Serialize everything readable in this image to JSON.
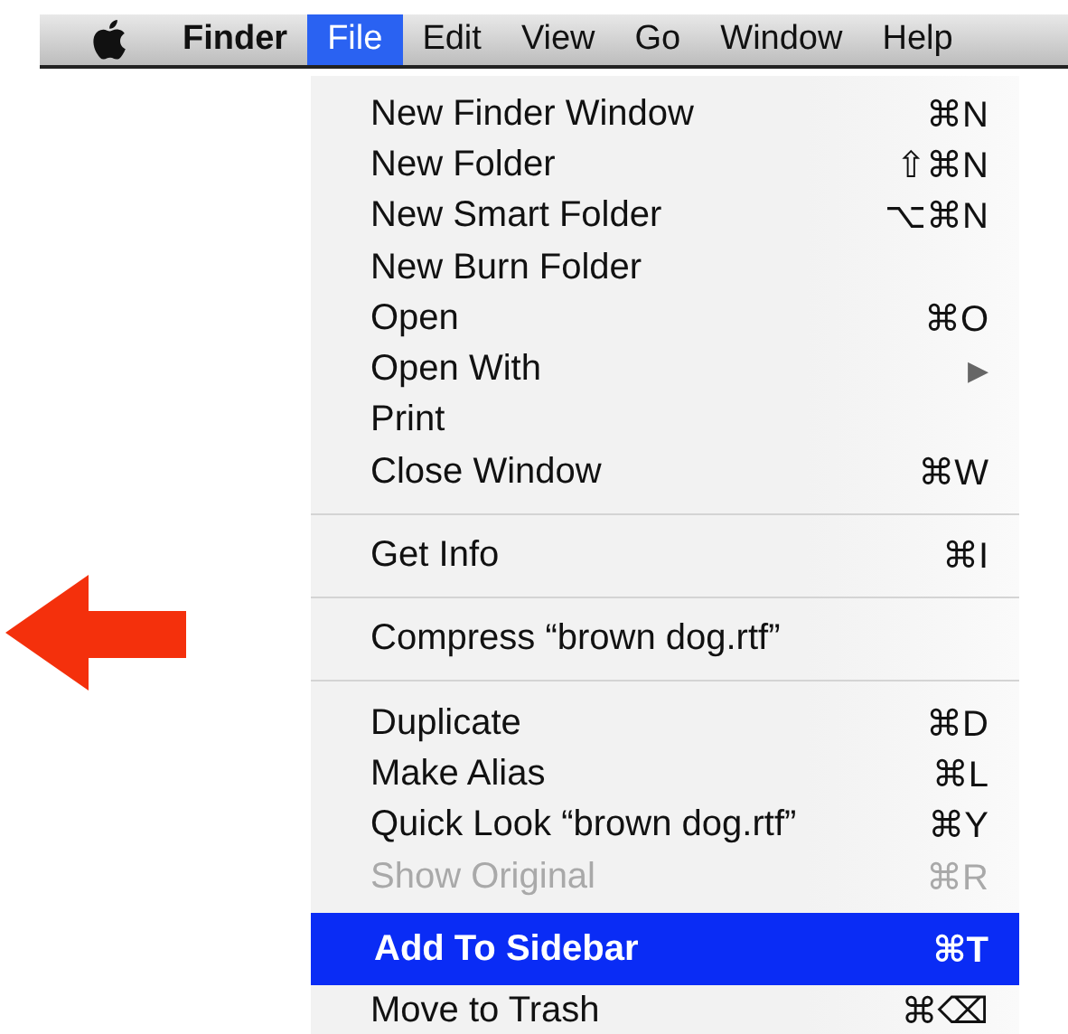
{
  "menu_bar": {
    "items": [
      {
        "label": "Finder",
        "selected": false,
        "bold": true
      },
      {
        "label": "File",
        "selected": true,
        "bold": false
      },
      {
        "label": "Edit",
        "selected": false,
        "bold": false
      },
      {
        "label": "View",
        "selected": false,
        "bold": false
      },
      {
        "label": "Go",
        "selected": false,
        "bold": false
      },
      {
        "label": "Window",
        "selected": false,
        "bold": false
      },
      {
        "label": "Help",
        "selected": false,
        "bold": false
      }
    ]
  },
  "file_menu": {
    "items": [
      {
        "kind": "item",
        "label": "New Finder Window",
        "shortcut": "⌘N",
        "disabled": false,
        "selected": false
      },
      {
        "kind": "item",
        "label": "New Folder",
        "shortcut": "⇧⌘N",
        "disabled": false,
        "selected": false
      },
      {
        "kind": "item",
        "label": "New Smart Folder",
        "shortcut": "⌥⌘N",
        "disabled": false,
        "selected": false
      },
      {
        "kind": "item",
        "label": "New Burn Folder",
        "disabled": false,
        "selected": false
      },
      {
        "kind": "item",
        "label": "Open",
        "shortcut": "⌘O",
        "disabled": false,
        "selected": false
      },
      {
        "kind": "submenu",
        "label": "Open With",
        "arrow": "▶",
        "disabled": false,
        "selected": false
      },
      {
        "kind": "item",
        "label": "Print",
        "disabled": false,
        "selected": false
      },
      {
        "kind": "item",
        "label": "Close Window",
        "shortcut": "⌘W",
        "disabled": false,
        "selected": false
      },
      {
        "kind": "separator"
      },
      {
        "kind": "item",
        "label": "Get Info",
        "shortcut": "⌘I",
        "disabled": false,
        "selected": false
      },
      {
        "kind": "separator"
      },
      {
        "kind": "item",
        "label": "Compress “brown dog.rtf”",
        "disabled": false,
        "selected": false
      },
      {
        "kind": "separator"
      },
      {
        "kind": "item",
        "label": "Duplicate",
        "shortcut": "⌘D",
        "disabled": false,
        "selected": false
      },
      {
        "kind": "item",
        "label": "Make Alias",
        "shortcut": "⌘L",
        "disabled": false,
        "selected": false
      },
      {
        "kind": "item",
        "label": "Quick Look “brown dog.rtf”",
        "shortcut": "⌘Y",
        "disabled": false,
        "selected": false
      },
      {
        "kind": "item",
        "label": "Show Original",
        "shortcut": "⌘R",
        "disabled": true,
        "selected": false
      },
      {
        "kind": "item",
        "label": "Add To Sidebar",
        "shortcut": "⌘T",
        "disabled": false,
        "selected": true
      },
      {
        "kind": "item",
        "label": "Move to Trash",
        "shortcut": "⌘⌫",
        "disabled": false,
        "selected": false
      }
    ]
  }
}
